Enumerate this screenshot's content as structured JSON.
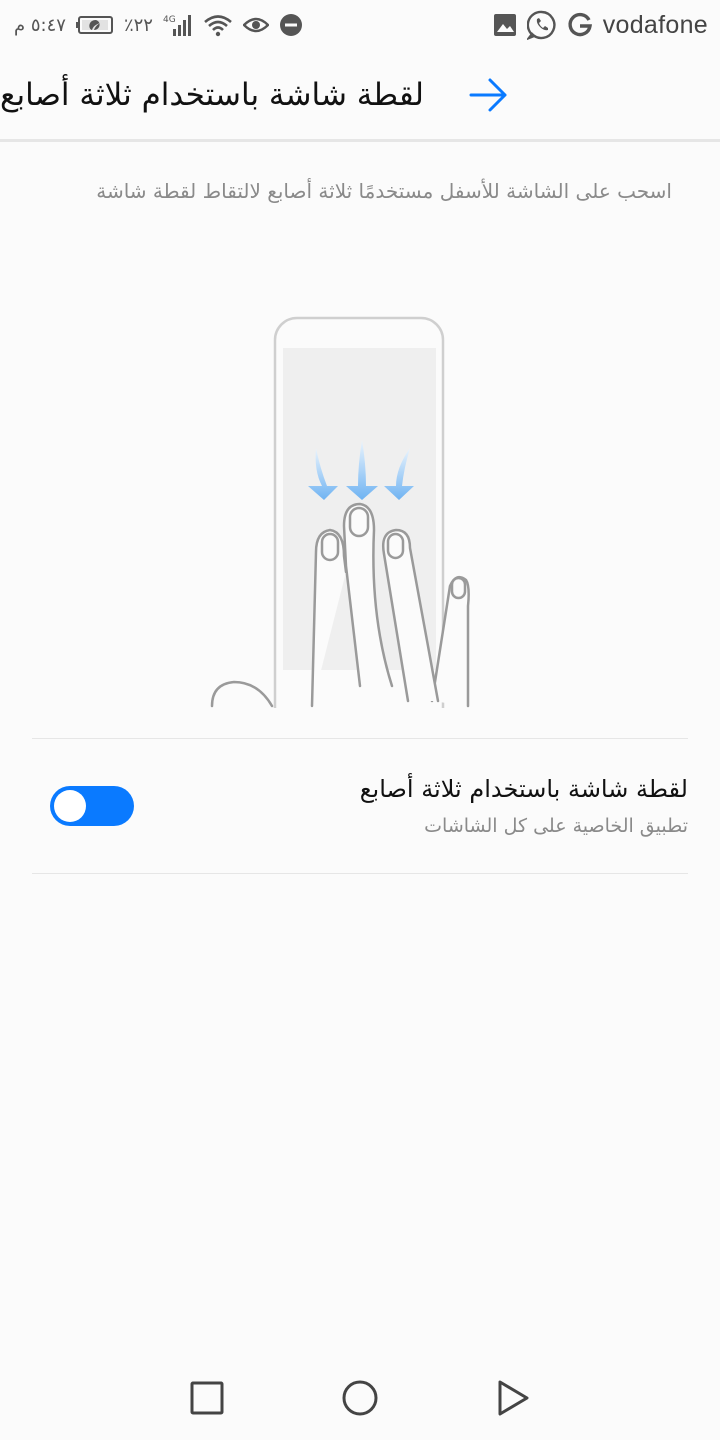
{
  "status_bar": {
    "time": "٥:٤٧ م",
    "battery": "٢٢٪",
    "network_type": "4G",
    "carrier": "vodafone",
    "icons": [
      "photo-icon",
      "whatsapp-icon",
      "google-icon",
      "dnd-icon",
      "eye-icon",
      "wifi-icon",
      "signal-icon",
      "battery-icon"
    ]
  },
  "header": {
    "title": "لقطة شاشة باستخدام ثلاثة أصابع",
    "back_icon": "arrow-back-icon"
  },
  "description": "اسحب على الشاشة للأسفل مستخدمًا ثلاثة أصابع لالتقاط لقطة شاشة",
  "setting": {
    "title": "لقطة شاشة باستخدام ثلاثة أصابع",
    "subtitle": "تطبيق الخاصية على كل الشاشات",
    "enabled": true
  },
  "colors": {
    "accent": "#0a7aff",
    "arrow_blue": "#8ec4f5"
  },
  "nav_bar": {
    "icons": [
      "recents-icon",
      "home-icon",
      "back-icon"
    ]
  }
}
